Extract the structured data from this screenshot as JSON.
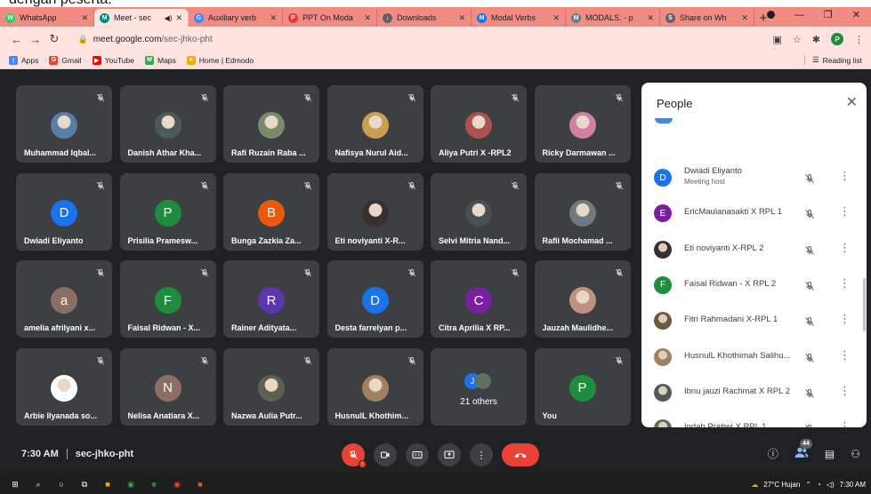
{
  "caption": "dengan peserta.",
  "tabs": [
    {
      "label": "WhatsApp",
      "color": "#25d366",
      "glyph": "W"
    },
    {
      "label": "Meet - sec",
      "color": "#00897b",
      "glyph": "M",
      "active": true,
      "audio": true
    },
    {
      "label": "Auxiliary verb",
      "color": "#4285f4",
      "glyph": "G"
    },
    {
      "label": "PPT On Moda",
      "color": "#e53935",
      "glyph": "P"
    },
    {
      "label": "Downloads",
      "color": "#5f6368",
      "glyph": "↓"
    },
    {
      "label": "Modal Verbs",
      "color": "#1a73e8",
      "glyph": "M"
    },
    {
      "label": "MODALS. - p",
      "color": "#607d8b",
      "glyph": "M"
    },
    {
      "label": "Share on Wh",
      "color": "#5f6368",
      "glyph": "S"
    }
  ],
  "address": {
    "host": "meet.google.com",
    "path": "/sec-jhko-pht"
  },
  "profile_initial": "P",
  "bookmarks": [
    {
      "label": "Apps",
      "color": "#4285f4",
      "glyph": "⋮"
    },
    {
      "label": "Gmail",
      "color": "#ea4335",
      "glyph": "G"
    },
    {
      "label": "YouTube",
      "color": "#ff0000",
      "glyph": "▶"
    },
    {
      "label": "Maps",
      "color": "#34a853",
      "glyph": "M"
    },
    {
      "label": "Home | Edmodo",
      "color": "#f9ab00",
      "glyph": "e"
    }
  ],
  "reading_list": "Reading list",
  "tiles": [
    {
      "name": "Muhammad Iqbal...",
      "avatar": "photo",
      "color": "#5b7ea6"
    },
    {
      "name": "Danish Athar Kha...",
      "avatar": "photo",
      "color": "#4a5a5a"
    },
    {
      "name": "Rafi Ruzain Raba ...",
      "avatar": "photo",
      "color": "#7a8a6a"
    },
    {
      "name": "Nafisya Nurul Aid...",
      "avatar": "photo",
      "color": "#c8a050"
    },
    {
      "name": "Aliya Putri X -RPL2",
      "avatar": "photo",
      "color": "#b05050"
    },
    {
      "name": "Ricky Darmawan ...",
      "avatar": "photo",
      "color": "#d080a0"
    },
    {
      "name": "Dwiadi Eliyanto",
      "avatar": "D",
      "color": "#1a73e8"
    },
    {
      "name": "Prisilia Pramesw...",
      "avatar": "P",
      "color": "#1e8e3e"
    },
    {
      "name": "Bunga Zazkia Za...",
      "avatar": "B",
      "color": "#e8590c"
    },
    {
      "name": "Eti noviyanti X-R...",
      "avatar": "photo",
      "color": "#3a3030"
    },
    {
      "name": "Selvi Mitria Nand...",
      "avatar": "photo",
      "color": "#4a5050"
    },
    {
      "name": "Rafli Mochamad ...",
      "avatar": "photo",
      "color": "#707880"
    },
    {
      "name": "amelia afrilyani x...",
      "avatar": "a",
      "color": "#8d6e63"
    },
    {
      "name": "Faisal Ridwan - X...",
      "avatar": "F",
      "color": "#1e8e3e"
    },
    {
      "name": "Rainer Adityata...",
      "avatar": "R",
      "color": "#5e35b1"
    },
    {
      "name": "Desta farrelyan p...",
      "avatar": "D",
      "color": "#1a73e8"
    },
    {
      "name": "Citra Aprilia X RP...",
      "avatar": "C",
      "color": "#7b1fa2"
    },
    {
      "name": "Jauzah Maulidhe...",
      "avatar": "photo",
      "color": "#c09080"
    },
    {
      "name": "Arbie Ilyanada so...",
      "avatar": "photo",
      "color": "#ffffff"
    },
    {
      "name": "Nelisa Anatiara X...",
      "avatar": "N",
      "color": "#8d6e63"
    },
    {
      "name": "Nazwa Aulia Putr...",
      "avatar": "photo",
      "color": "#606050"
    },
    {
      "name": "HusnulL Khothim...",
      "avatar": "photo",
      "color": "#a08060"
    },
    {
      "name": "",
      "avatar": "others",
      "color": "#3c4043",
      "others_label": "21 others"
    },
    {
      "name": "You",
      "avatar": "P",
      "color": "#1e8e3e"
    }
  ],
  "others_avatar_initial": "J",
  "people_panel": {
    "title": "People",
    "participants": [
      {
        "name": "Dwiadi Eliyanto",
        "sub": "Meeting host",
        "avatar": "D",
        "color": "#1a73e8"
      },
      {
        "name": "EricMaulanasakti X RPL 1",
        "avatar": "E",
        "color": "#7b1fa2"
      },
      {
        "name": "Eti noviyanti X-RPL 2",
        "avatar": "photo",
        "color": "#3a3030"
      },
      {
        "name": "Faisal Ridwan - X RPL 2",
        "avatar": "F",
        "color": "#1e8e3e"
      },
      {
        "name": "Fitri Rahmadani X-RPL 1",
        "avatar": "photo",
        "color": "#6a5a40"
      },
      {
        "name": "HusnulL Khothimah Salihu...",
        "avatar": "photo",
        "color": "#a08060"
      },
      {
        "name": "Ibnu jauzi Rachmat X RPL 2",
        "avatar": "photo",
        "color": "#505a50"
      },
      {
        "name": "Indah Pratiwi X RPL 1",
        "avatar": "photo",
        "color": "#5a7060"
      }
    ]
  },
  "meeting": {
    "time": "7:30 AM",
    "code": "sec-jhko-pht"
  },
  "people_count": "44",
  "tray": {
    "weather": "27°C  Hujan",
    "time": "7:30 AM"
  }
}
